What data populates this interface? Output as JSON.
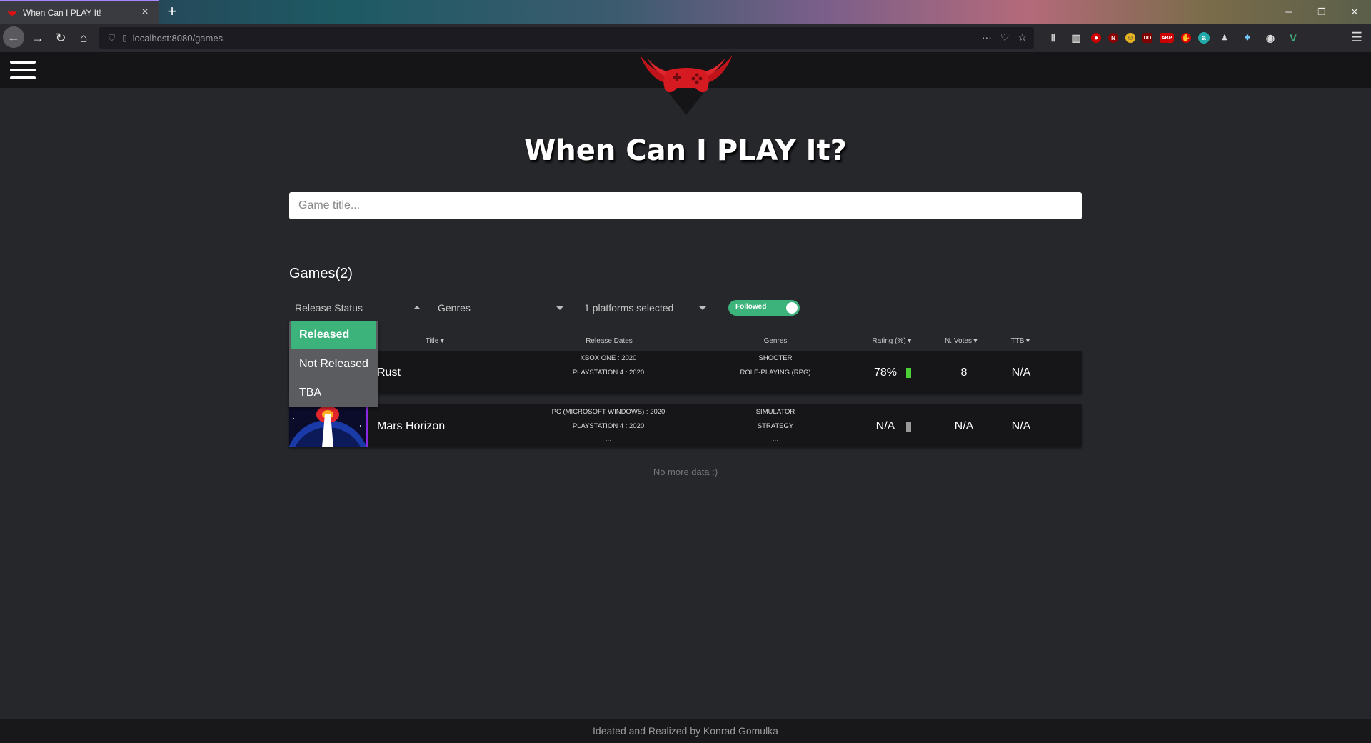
{
  "browser": {
    "tab_title": "When Can I PLAY It!",
    "url": "localhost:8080/games"
  },
  "app": {
    "title": "When Can I PLAY It?",
    "search_placeholder": "Game title...",
    "games_heading": "Games(2)",
    "filters": {
      "release_status": "Release Status",
      "genres": "Genres",
      "platforms": "1 platforms selected",
      "followed_label": "Followed",
      "followed_on": true
    },
    "release_status_options": [
      {
        "label": "Released",
        "selected": true
      },
      {
        "label": "Not Released",
        "selected": false
      },
      {
        "label": "TBA",
        "selected": false
      }
    ],
    "columns": {
      "title": "Title▼",
      "release_dates": "Release Dates",
      "genres": "Genres",
      "rating": "Rating (%)▼",
      "votes": "N. Votes▼",
      "ttb": "TTB▼"
    },
    "games": [
      {
        "title": "Rust",
        "release_dates": [
          "XBOX ONE : 2020",
          "PLAYSTATION 4 : 2020"
        ],
        "genres": [
          "SHOOTER",
          "ROLE-PLAYING (RPG)",
          "..."
        ],
        "rating": "78%",
        "rating_color": "#4cd137",
        "votes": "8",
        "ttb": "N/A"
      },
      {
        "title": "Mars Horizon",
        "release_dates": [
          "PC (MICROSOFT WINDOWS) : 2020",
          "PLAYSTATION 4 : 2020",
          "..."
        ],
        "genres": [
          "SIMULATOR",
          "STRATEGY",
          "..."
        ],
        "rating": "N/A",
        "rating_color": "#999999",
        "votes": "N/A",
        "ttb": "N/A"
      }
    ],
    "no_more": "No more data :)",
    "footer": "Ideated and Realized by Konrad Gomulka"
  }
}
